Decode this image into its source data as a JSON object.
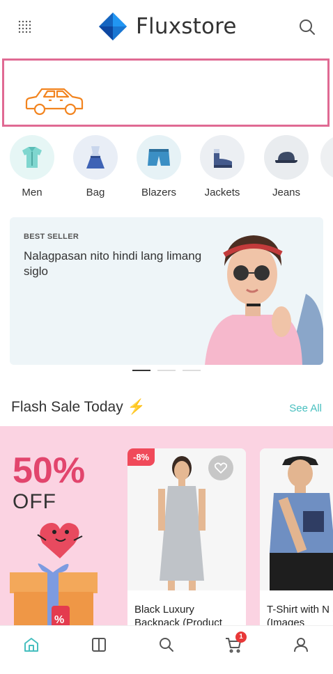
{
  "header": {
    "brand": "Fluxstore",
    "brand_color": "#1e88e5"
  },
  "promo_banner": {
    "icon": "car-icon",
    "border_color": "#e06a93",
    "icon_color": "#f2841f"
  },
  "categories": [
    {
      "label": "Men",
      "icon": "shirt-icon",
      "bg": "#e6f6f5"
    },
    {
      "label": "Bag",
      "icon": "dress-icon",
      "bg": "#e9eef6"
    },
    {
      "label": "Blazers",
      "icon": "shorts-icon",
      "bg": "#e6f2f6"
    },
    {
      "label": "Jackets",
      "icon": "shoe-icon",
      "bg": "#eceff3"
    },
    {
      "label": "Jeans",
      "icon": "cap-icon",
      "bg": "#e9ecef"
    }
  ],
  "hero": {
    "tag": "BEST SELLER",
    "title": "Nalagpasan nito hindi lang limang siglo",
    "slides_total": 3,
    "slide_active": 1
  },
  "flash_sale": {
    "title": "Flash Sale Today",
    "see_all": "See All",
    "promo_percent": "50%",
    "promo_off": "OFF",
    "promo_tag": "%",
    "products": [
      {
        "name": "Black Luxury Backpack (Product",
        "discount": "-8%"
      },
      {
        "name": "T-Shirt with N Stop (Images"
      }
    ]
  },
  "bottom_nav": {
    "items": [
      "home-icon",
      "layout-icon",
      "search-icon",
      "cart-icon",
      "user-icon"
    ],
    "active": "home-icon",
    "active_color": "#47bfbf",
    "cart_count": "1"
  }
}
